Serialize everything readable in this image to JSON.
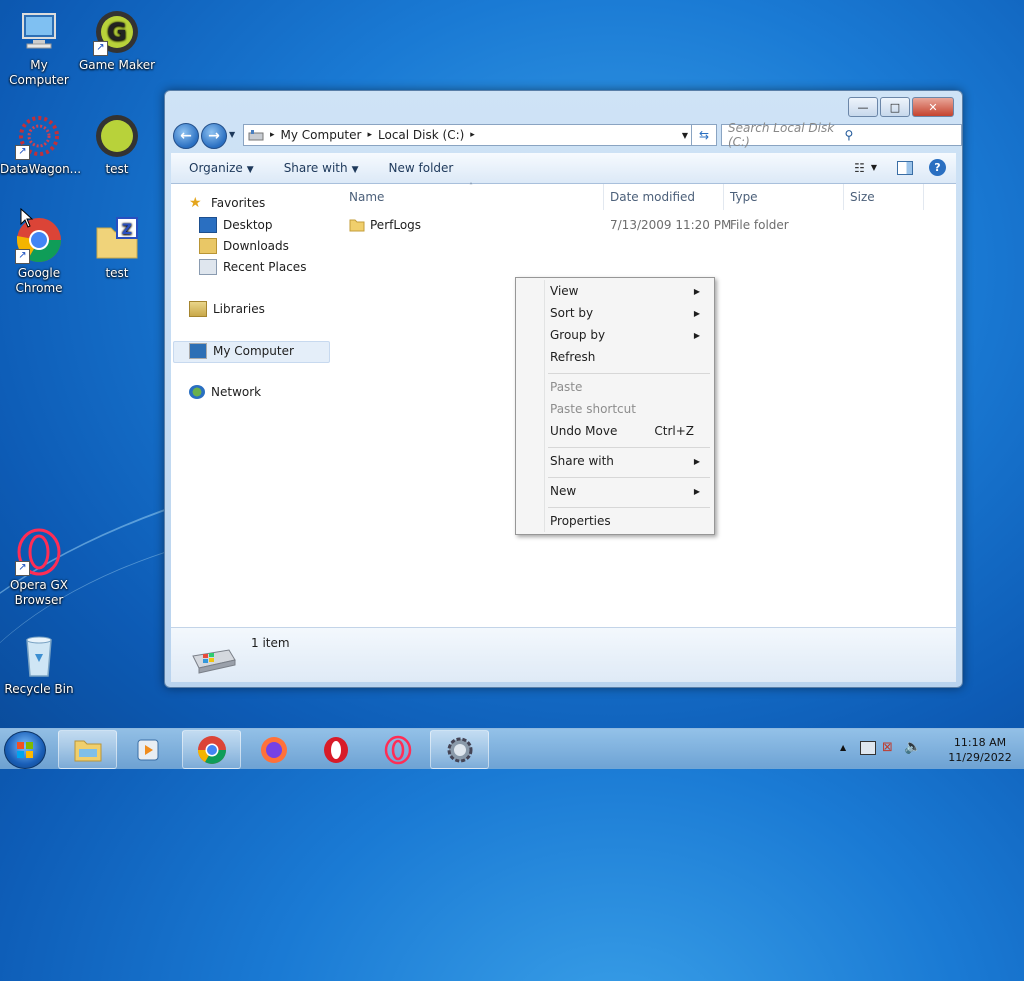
{
  "desktop": {
    "icons": [
      {
        "label": "My Computer"
      },
      {
        "label": "Game Maker"
      },
      {
        "label": "DataWagon..."
      },
      {
        "label": "test"
      },
      {
        "label": "Google Chrome"
      },
      {
        "label": "test"
      },
      {
        "label": "Opera GX Browser"
      },
      {
        "label": "Recycle Bin"
      }
    ]
  },
  "window": {
    "controls": {
      "minimize": "—",
      "maximize": "□",
      "close": "✕"
    },
    "address": {
      "segments": [
        "My Computer",
        "Local Disk (C:)"
      ],
      "separator": "▸"
    },
    "search": {
      "placeholder": "Search Local Disk (C:)"
    },
    "toolbar": {
      "organize": "Organize",
      "share_with": "Share with",
      "new_folder": "New folder"
    },
    "nav": {
      "favorites": "Favorites",
      "desktop": "Desktop",
      "downloads": "Downloads",
      "recent_places": "Recent Places",
      "libraries": "Libraries",
      "my_computer": "My Computer",
      "network": "Network"
    },
    "columns": {
      "name": "Name",
      "date_modified": "Date modified",
      "type": "Type",
      "size": "Size"
    },
    "files": [
      {
        "name": "PerfLogs",
        "date": "7/13/2009 11:20 PM",
        "type": "File folder",
        "size": ""
      }
    ],
    "status": {
      "count": "1 item"
    }
  },
  "context_menu": {
    "items": [
      {
        "label": "View",
        "submenu": true,
        "disabled": false
      },
      {
        "label": "Sort by",
        "submenu": true,
        "disabled": false
      },
      {
        "label": "Group by",
        "submenu": true,
        "disabled": false
      },
      {
        "label": "Refresh",
        "submenu": false,
        "disabled": false
      },
      {
        "label": "Paste",
        "submenu": false,
        "disabled": true
      },
      {
        "label": "Paste shortcut",
        "submenu": false,
        "disabled": true
      },
      {
        "label": "Undo Move",
        "shortcut": "Ctrl+Z",
        "disabled": false
      },
      {
        "label": "Share with",
        "submenu": true,
        "disabled": false
      },
      {
        "label": "New",
        "submenu": true,
        "disabled": false
      },
      {
        "label": "Properties",
        "submenu": false,
        "disabled": false
      }
    ]
  },
  "taskbar": {
    "clock_time": "11:18 AM",
    "clock_date": "11/29/2022",
    "tray_arrow": "▲"
  },
  "colors": {
    "accent": "#2a6fc1",
    "desktop": "#1a7ad4",
    "close": "#c5432e"
  }
}
